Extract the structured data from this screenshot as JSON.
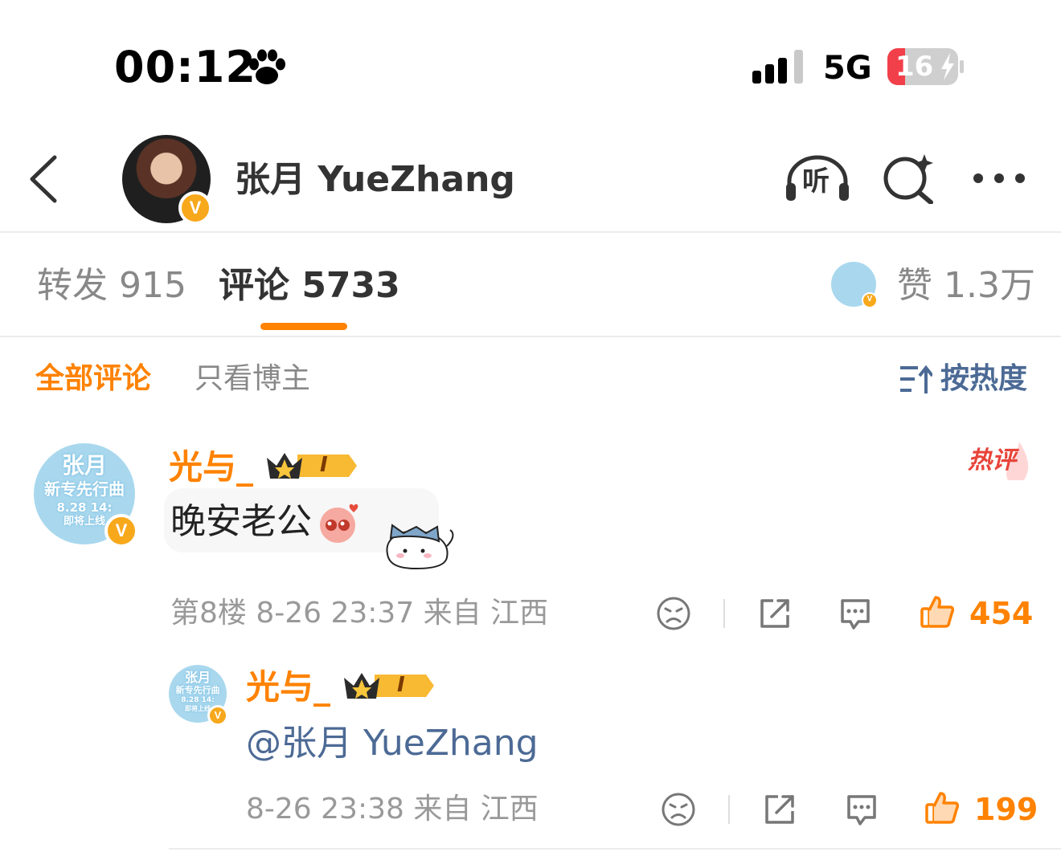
{
  "status_bar": {
    "time": "00:12",
    "network": "5G",
    "battery": "16"
  },
  "header": {
    "title": "张月 YueZhang",
    "listen_label": "听"
  },
  "tabs": {
    "repost": "转发 915",
    "comment": "评论 5733",
    "like": "赞 1.3万"
  },
  "filters": {
    "all": "全部评论",
    "host_only": "只看博主",
    "sort": "按热度"
  },
  "avatar_badge": {
    "line1": "张月",
    "line2": "新专先行曲",
    "line3": "8.28 14:",
    "line4": "即将上线"
  },
  "comments": [
    {
      "user": "光与_",
      "level": "I",
      "text": "晚安老公",
      "hot_label": "热评",
      "meta": "第8楼 8-26 23:37 来自 江西",
      "likes": "454"
    }
  ],
  "replies": [
    {
      "user": "光与_",
      "level": "I",
      "text": "@张月 YueZhang",
      "meta": "8-26 23:38 来自 江西",
      "likes": "199"
    }
  ],
  "colors": {
    "accent": "#ff8200",
    "link": "#4c6a95",
    "meta": "#999999",
    "badge": "#f7a81b"
  }
}
